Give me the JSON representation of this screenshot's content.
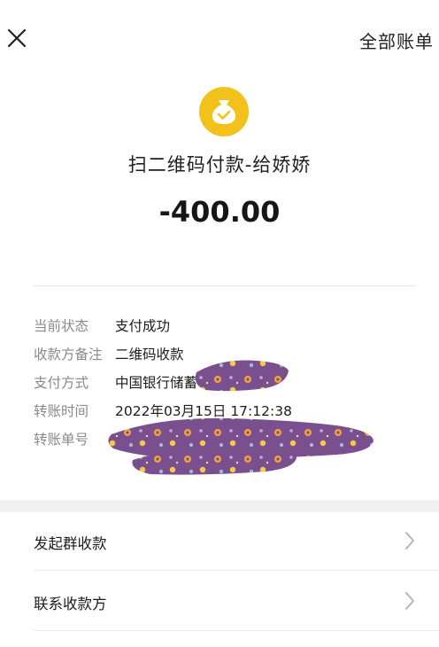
{
  "topbar": {
    "status_sliver": "",
    "all_bills_label": "全部账单"
  },
  "summary": {
    "title": "扫二维码付款-给娇娇",
    "amount": "-400.00",
    "icon_color": "#f2c21a"
  },
  "details": {
    "rows": [
      {
        "label": "当前状态",
        "value": "支付成功"
      },
      {
        "label": "收款方备注",
        "value": "二维码收款"
      },
      {
        "label": "支付方式",
        "value": "中国银行储蓄卡"
      },
      {
        "label": "转账时间",
        "value": "2022年03月15日 17:12:38"
      },
      {
        "label": "转账单号",
        "value": ""
      }
    ]
  },
  "menu": {
    "items": [
      {
        "label": "发起群收款"
      },
      {
        "label": "联系收款方"
      }
    ]
  },
  "colors": {
    "redaction": "#7a4f8e",
    "section_gap": "#f1f1f1"
  }
}
